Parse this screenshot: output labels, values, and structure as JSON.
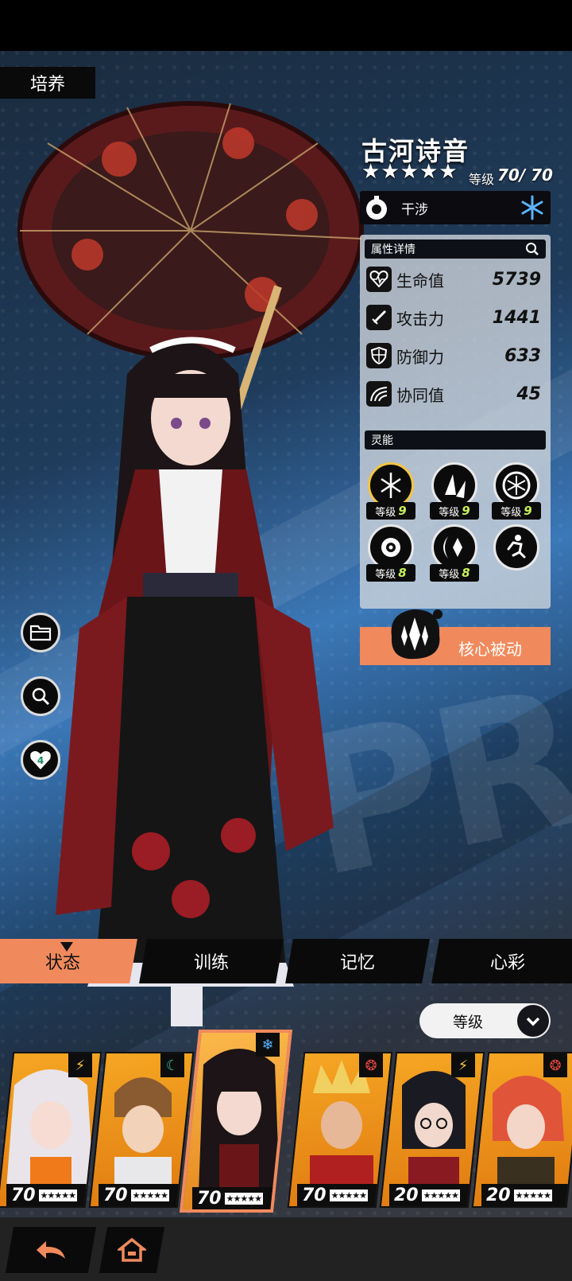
{
  "page": {
    "title": "培养"
  },
  "character": {
    "name": "古河诗音",
    "stars": 5,
    "level_label": "等级",
    "level_value": "70/ 70",
    "role": "干涉",
    "element_icon": "snowflake-icon"
  },
  "attributes": {
    "header": "属性详情",
    "stats": [
      {
        "label": "生命值",
        "value": "5739",
        "icon": "heart-pulse-icon"
      },
      {
        "label": "攻击力",
        "value": "1441",
        "icon": "sword-icon"
      },
      {
        "label": "防御力",
        "value": "633",
        "icon": "shield-icon"
      },
      {
        "label": "协同值",
        "value": "45",
        "icon": "rainbow-icon"
      }
    ]
  },
  "psy": {
    "header": "灵能",
    "skills": [
      {
        "label": "等级",
        "level": "9",
        "icon": "snow-tree-icon"
      },
      {
        "label": "等级",
        "level": "9",
        "icon": "ice-shards-icon"
      },
      {
        "label": "等级",
        "level": "9",
        "icon": "snowflake-swirl-icon"
      },
      {
        "label": "等级",
        "level": "8",
        "icon": "rose-icon"
      },
      {
        "label": "等级",
        "level": "8",
        "icon": "moon-crystal-icon"
      },
      {
        "label": "",
        "level": "",
        "icon": "dash-icon"
      }
    ]
  },
  "core_passive": {
    "label": "核心被动"
  },
  "side_buttons": [
    "folder-icon",
    "search-icon",
    "heart-badge-icon"
  ],
  "tabs": [
    {
      "label": "状态",
      "active": true
    },
    {
      "label": "训练",
      "active": false
    },
    {
      "label": "记忆",
      "active": false
    },
    {
      "label": "心彩",
      "active": false
    }
  ],
  "sort": {
    "label": "等级"
  },
  "roster": [
    {
      "level": "70",
      "stars": "★★★★★",
      "elem": "⚡",
      "elem_color": "#f5c542",
      "selected": false
    },
    {
      "level": "70",
      "stars": "★★★★★",
      "elem": "☾",
      "elem_color": "#3fbf8f",
      "selected": false
    },
    {
      "level": "70",
      "stars": "★★★★★",
      "elem": "❄",
      "elem_color": "#5ab4ff",
      "selected": true
    },
    {
      "level": "70",
      "stars": "★★★★★",
      "elem": "❂",
      "elem_color": "#e0453a",
      "selected": false
    },
    {
      "level": "20",
      "stars": "★★★★★",
      "elem": "⚡",
      "elem_color": "#f5c542",
      "selected": false
    },
    {
      "level": "20",
      "stars": "★★★★★",
      "elem": "❂",
      "elem_color": "#e0453a",
      "selected": false
    }
  ],
  "nav": {
    "back": "back-arrow-icon",
    "home": "home-icon"
  },
  "colors": {
    "accent": "#f08a5d",
    "panel": "#d2d7de",
    "level_green": "#c8f05a",
    "card_orange": "#f5a623"
  }
}
